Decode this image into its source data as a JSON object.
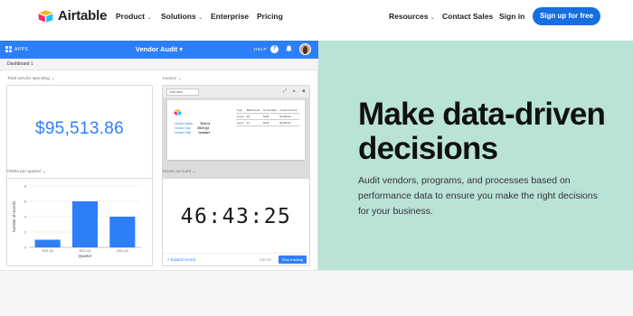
{
  "nav": {
    "brand": "Airtable",
    "links": [
      {
        "label": "Product",
        "dropdown": true
      },
      {
        "label": "Solutions",
        "dropdown": true
      },
      {
        "label": "Enterprise",
        "dropdown": false
      },
      {
        "label": "Pricing",
        "dropdown": false
      }
    ],
    "right_links": [
      {
        "label": "Resources",
        "dropdown": true
      },
      {
        "label": "Contact Sales",
        "dropdown": false
      },
      {
        "label": "Sign in",
        "dropdown": false
      }
    ],
    "cta": "Sign up for free",
    "chevron": "⌄"
  },
  "hero": {
    "headline": "Make data-driven decisions",
    "subcopy": "Audit vendors, programs, and processes based on performance data to ensure you make the right decisions for your business."
  },
  "app": {
    "apps_label": "APPS",
    "base_title": "Vendor Audit ▾",
    "help_label": "HELP",
    "help_icon": "?",
    "dashboard_label": "Dashboard 1",
    "panels": {
      "vendor_spending": {
        "label": "Total vendor spending  ⌄",
        "value": "$95,513.86"
      },
      "invoice": {
        "label": "Invoice  ⌄",
        "select": "Grid view",
        "tools": "⤢ ▸ ■",
        "lines": [
          {
            "k": "Vendor Name",
            "v": "Tech is"
          },
          {
            "k": "Vendor Sna",
            "v": "2019 Q4"
          },
          {
            "k": "Vendor Date",
            "v": "October"
          }
        ],
        "table_header": [
          "Type",
          "Billed Hours",
          "Hourly Rate",
          "Invoice Amount"
        ],
        "table_rows": [
          [
            "Lorem",
            "48",
            "$150",
            "$7,200.00"
          ],
          [
            "Ipsum",
            "24",
            "$125",
            "$3,000.00"
          ]
        ]
      },
      "okrs": {
        "label": "OKRs per quarter  ⌄",
        "chart_data": {
          "type": "bar",
          "categories": [
            "2021 Q1",
            "2021 Q2",
            "2021 Q3"
          ],
          "values": [
            1,
            6,
            4
          ],
          "ylim": [
            0,
            8
          ],
          "yticks": [
            0,
            2,
            4,
            6,
            8
          ],
          "xlabel": "Quarter",
          "ylabel": "Number of records",
          "grid": true,
          "color": "#2d7ff9"
        }
      },
      "hours": {
        "label": "Hours accrued  ⌄",
        "timer": "46:43:25",
        "expand": "↗ Expand record",
        "cancel": "Cancel",
        "stop": "Stop tracking"
      }
    }
  },
  "colors": {
    "brand_blue": "#166ee1",
    "app_blue": "#2d7ff9",
    "hero_mint": "#bae3d8"
  }
}
